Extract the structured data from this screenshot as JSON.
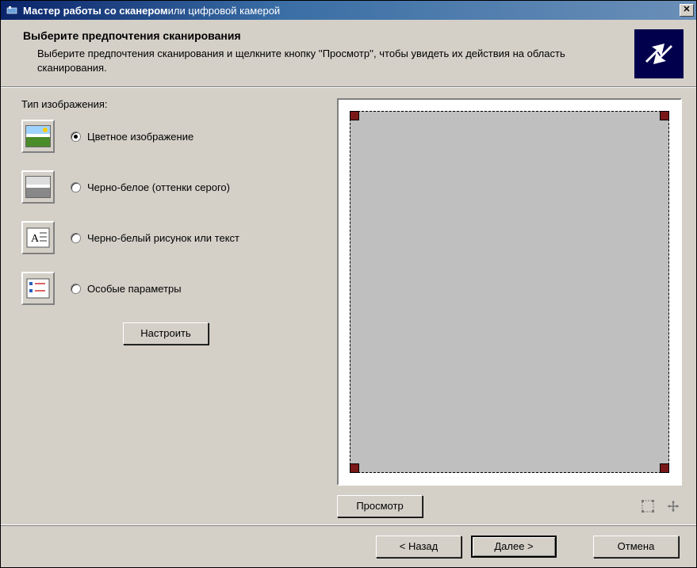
{
  "window": {
    "title_main": "Мастер работы со сканером",
    "title_rest": " или цифровой камерой"
  },
  "header": {
    "title": "Выберите предпочтения сканирования",
    "subtitle": "Выберите предпочтения сканирования и щелкните кнопку ''Просмотр'', чтобы увидеть их действия на область сканирования."
  },
  "left": {
    "type_label": "Тип изображения:",
    "options": [
      {
        "id": "color",
        "label": "Цветное изображение",
        "checked": true
      },
      {
        "id": "grayscale",
        "label": "Черно-белое (оттенки серого)",
        "checked": false
      },
      {
        "id": "bw-text",
        "label": "Черно-белый рисунок или текст",
        "checked": false
      },
      {
        "id": "custom",
        "label": "Особые параметры",
        "checked": false
      }
    ],
    "configure_button": "Настроить"
  },
  "right": {
    "preview_button": "Просмотр",
    "icon_select_name": "select-region-icon",
    "icon_fit_name": "fit-view-icon"
  },
  "footer": {
    "back": "< Назад",
    "next": "Далее >",
    "cancel": "Отмена"
  }
}
